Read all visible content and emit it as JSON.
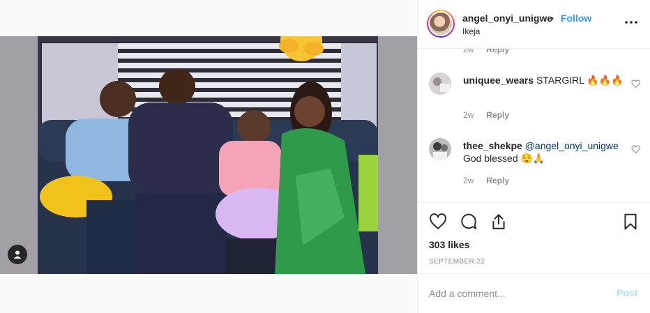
{
  "post": {
    "username": "angel_onyi_unigwe",
    "separator": "•",
    "follow_label": "Follow",
    "location": "Ikeja",
    "more_icon": "more-options-icon",
    "photo_icon": "user-tag-icon"
  },
  "partial_comment": {
    "time": "2w",
    "reply_label": "Reply"
  },
  "comments": [
    {
      "username": "uniquee_wears",
      "text": "STARGIRL 🔥🔥🔥",
      "time": "2w",
      "reply_label": "Reply"
    },
    {
      "username": "thee_shekpe",
      "mention": "@angel_onyi_unigwe",
      "text": "God blessed 😌🙏",
      "time": "2w",
      "reply_label": "Reply"
    }
  ],
  "actions": {
    "icons": [
      "heart-icon",
      "comment-icon",
      "share-icon",
      "bookmark-icon"
    ],
    "likes": "303 likes",
    "date": "SEPTEMBER 22"
  },
  "add_comment": {
    "placeholder": "Add a comment...",
    "post_label": "Post"
  },
  "colors": {
    "link": "#3897f0",
    "muted": "#8e8e8e",
    "text": "#262626",
    "post_disabled": "#b2dffc"
  }
}
